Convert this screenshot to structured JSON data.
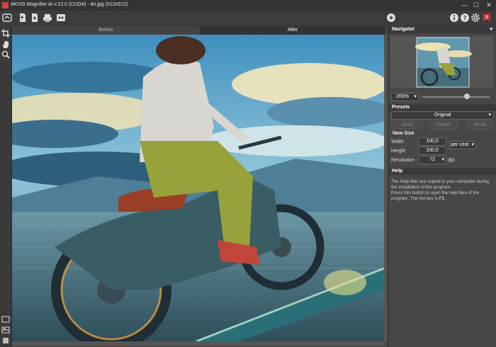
{
  "window": {
    "title": "AKVIS Magnifier AI v.12.0 (CUDA) - do.jpg (512x512)",
    "minimize": "—",
    "maximize": "☐",
    "close": "✕"
  },
  "tabs": {
    "before": "Before",
    "after": "After"
  },
  "navigator": {
    "header": "Navigator",
    "zoom": "200%"
  },
  "presets": {
    "header": "Presets",
    "selected": "Original",
    "save": "Save",
    "delete": "Delete",
    "reset": "Reset"
  },
  "new_size": {
    "header": "New Size",
    "width_label": "Width",
    "width_value": "100,0",
    "height_label": "Height",
    "height_value": "100,0",
    "unit": "per cent",
    "resolution_label": "Resolution",
    "resolution_value": "72",
    "resolution_unit": "dpi"
  },
  "help": {
    "header": "Help",
    "line1": "The Help files are copied to your computer during",
    "line2": "the installation of the program.",
    "line3": "Press this button to open the help files of the",
    "line4": "program. The hot key is ",
    "hotkey": "F1",
    "end": "."
  },
  "icons": {
    "run": "play-icon",
    "info": "info-icon",
    "help": "help-icon",
    "settings": "gear-icon",
    "notify": "notification-icon"
  }
}
